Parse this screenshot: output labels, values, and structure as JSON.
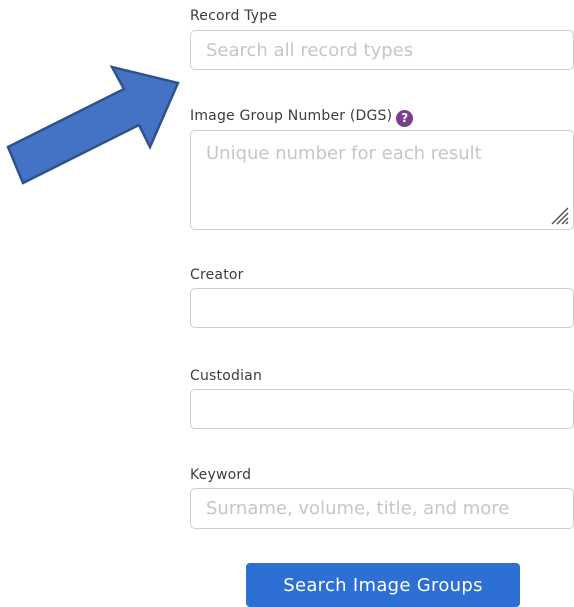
{
  "form": {
    "record_type": {
      "label": "Record Type",
      "placeholder": "Search all record types"
    },
    "image_group_number": {
      "label": "Image Group Number (DGS)",
      "placeholder": "Unique number for each result",
      "help_glyph": "?"
    },
    "creator": {
      "label": "Creator",
      "value": ""
    },
    "custodian": {
      "label": "Custodian",
      "value": ""
    },
    "keyword": {
      "label": "Keyword",
      "placeholder": "Surname, volume, title, and more"
    },
    "submit_label": "Search Image Groups"
  },
  "colors": {
    "button": "#2e6fd4",
    "help": "#7b3f8f",
    "arrow_fill": "#4472c4",
    "arrow_stroke": "#2f528f"
  }
}
